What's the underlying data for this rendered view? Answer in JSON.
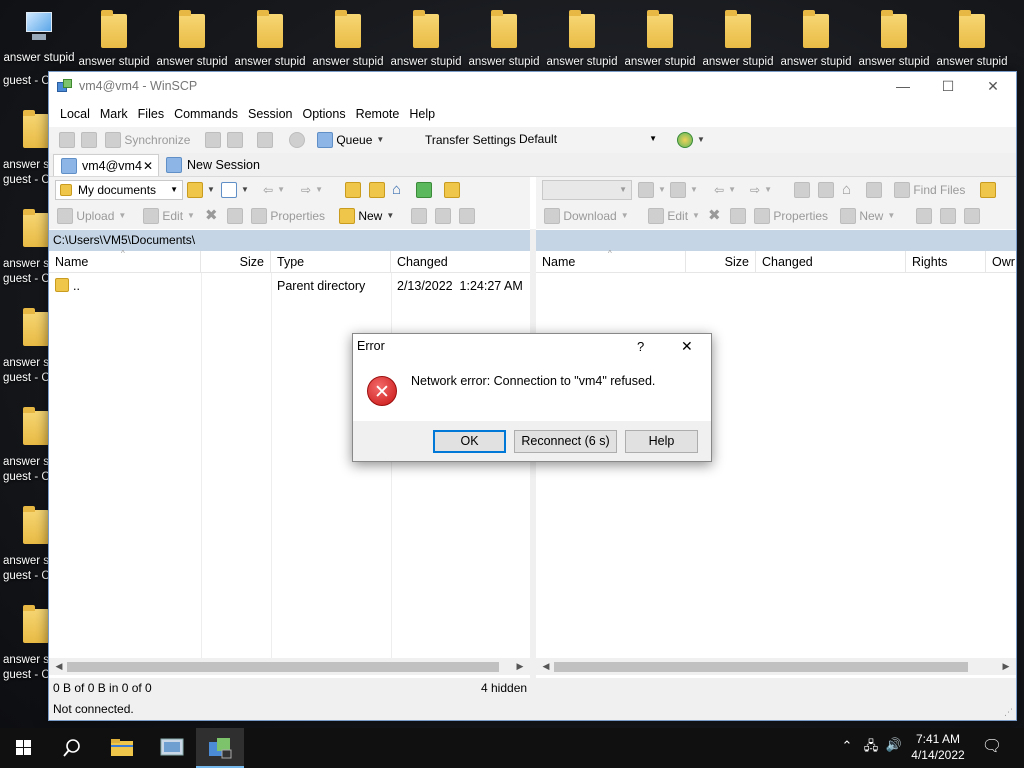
{
  "desktop": {
    "top_label_line": "answer stupid",
    "top_labels": [
      "answer stupid",
      "answer stupid",
      "answer stupid",
      "answer stupid",
      "answer stupid",
      "answer stupid",
      "answer stupid",
      "answer stupid",
      "answer stupid",
      "answer stupid",
      "answer stupid",
      "answer stupid",
      "answer stupid"
    ],
    "side_line1": "answer s",
    "side_line2": "guest - C",
    "side_first_line2": "guest - C"
  },
  "window": {
    "title": "vm4@vm4 - WinSCP",
    "minimize": "—",
    "maximize": "☐",
    "close": "✕"
  },
  "menu": [
    "Local",
    "Mark",
    "Files",
    "Commands",
    "Session",
    "Options",
    "Remote",
    "Help"
  ],
  "toolbar": {
    "synchronize": "Synchronize",
    "queue": "Queue",
    "transfer_settings_label": "Transfer Settings",
    "transfer_settings_value": "Default"
  },
  "tabs": {
    "session": "vm4@vm4",
    "close": "✕",
    "new_session": "New Session"
  },
  "left_pane": {
    "location": "My documents",
    "upload": "Upload",
    "edit": "Edit",
    "properties": "Properties",
    "new": "New",
    "path": "C:\\Users\\VM5\\Documents\\",
    "columns": {
      "name": "Name",
      "size": "Size",
      "type": "Type",
      "changed": "Changed"
    },
    "rows": [
      {
        "name": "..",
        "size": "",
        "type": "Parent directory",
        "changed": "2/13/2022  1:24:27 AM"
      }
    ],
    "status_left": "0 B of 0 B in 0 of 0",
    "status_right": "4 hidden"
  },
  "right_pane": {
    "find_files": "Find Files",
    "download": "Download",
    "edit": "Edit",
    "properties": "Properties",
    "new": "New",
    "columns": {
      "name": "Name",
      "size": "Size",
      "changed": "Changed",
      "rights": "Rights",
      "owner": "Owr"
    }
  },
  "status_bar": "Not connected.",
  "dialog": {
    "title": "Error",
    "help_glyph": "?",
    "close": "✕",
    "message": "Network error: Connection to \"vm4\" refused.",
    "ok": "OK",
    "reconnect": "Reconnect (6 s)",
    "help": "Help"
  },
  "taskbar": {
    "time": "7:41 AM",
    "date": "4/14/2022"
  },
  "colors": {
    "path_bar": "#c5d5e5",
    "error_red": "#c91414",
    "default_button_border": "#0078d7",
    "taskbar": "#101010"
  }
}
